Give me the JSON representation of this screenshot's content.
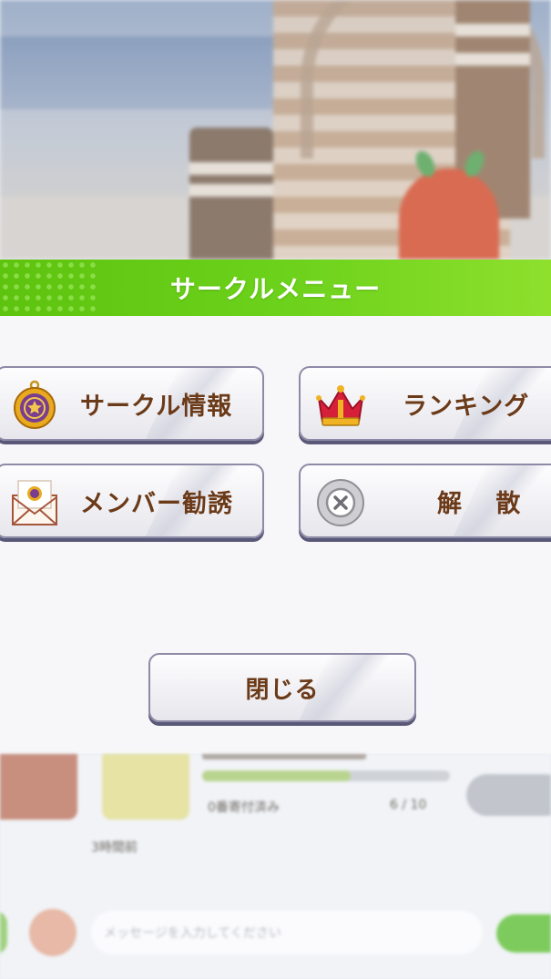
{
  "header": {
    "title": "サークルメニュー"
  },
  "menu": {
    "info": {
      "label": "サークル情報",
      "icon": "circle-emblem-icon"
    },
    "ranking": {
      "label": "ランキング",
      "icon": "crown-icon"
    },
    "invite": {
      "label": "メンバー勧誘",
      "icon": "envelope-icon"
    },
    "dissolve": {
      "label": "解 散",
      "icon": "x-circle-icon"
    }
  },
  "close_button": {
    "label": "閉じる"
  },
  "background": {
    "member_count": "6 / 10",
    "status_text": "0番寄付済み",
    "time_text": "3時間前",
    "message_placeholder": "メッセージを入力してください"
  },
  "colors": {
    "header_green": "#6bd11a",
    "label_brown": "#6b3a18",
    "button_border": "#8c8aa6"
  }
}
